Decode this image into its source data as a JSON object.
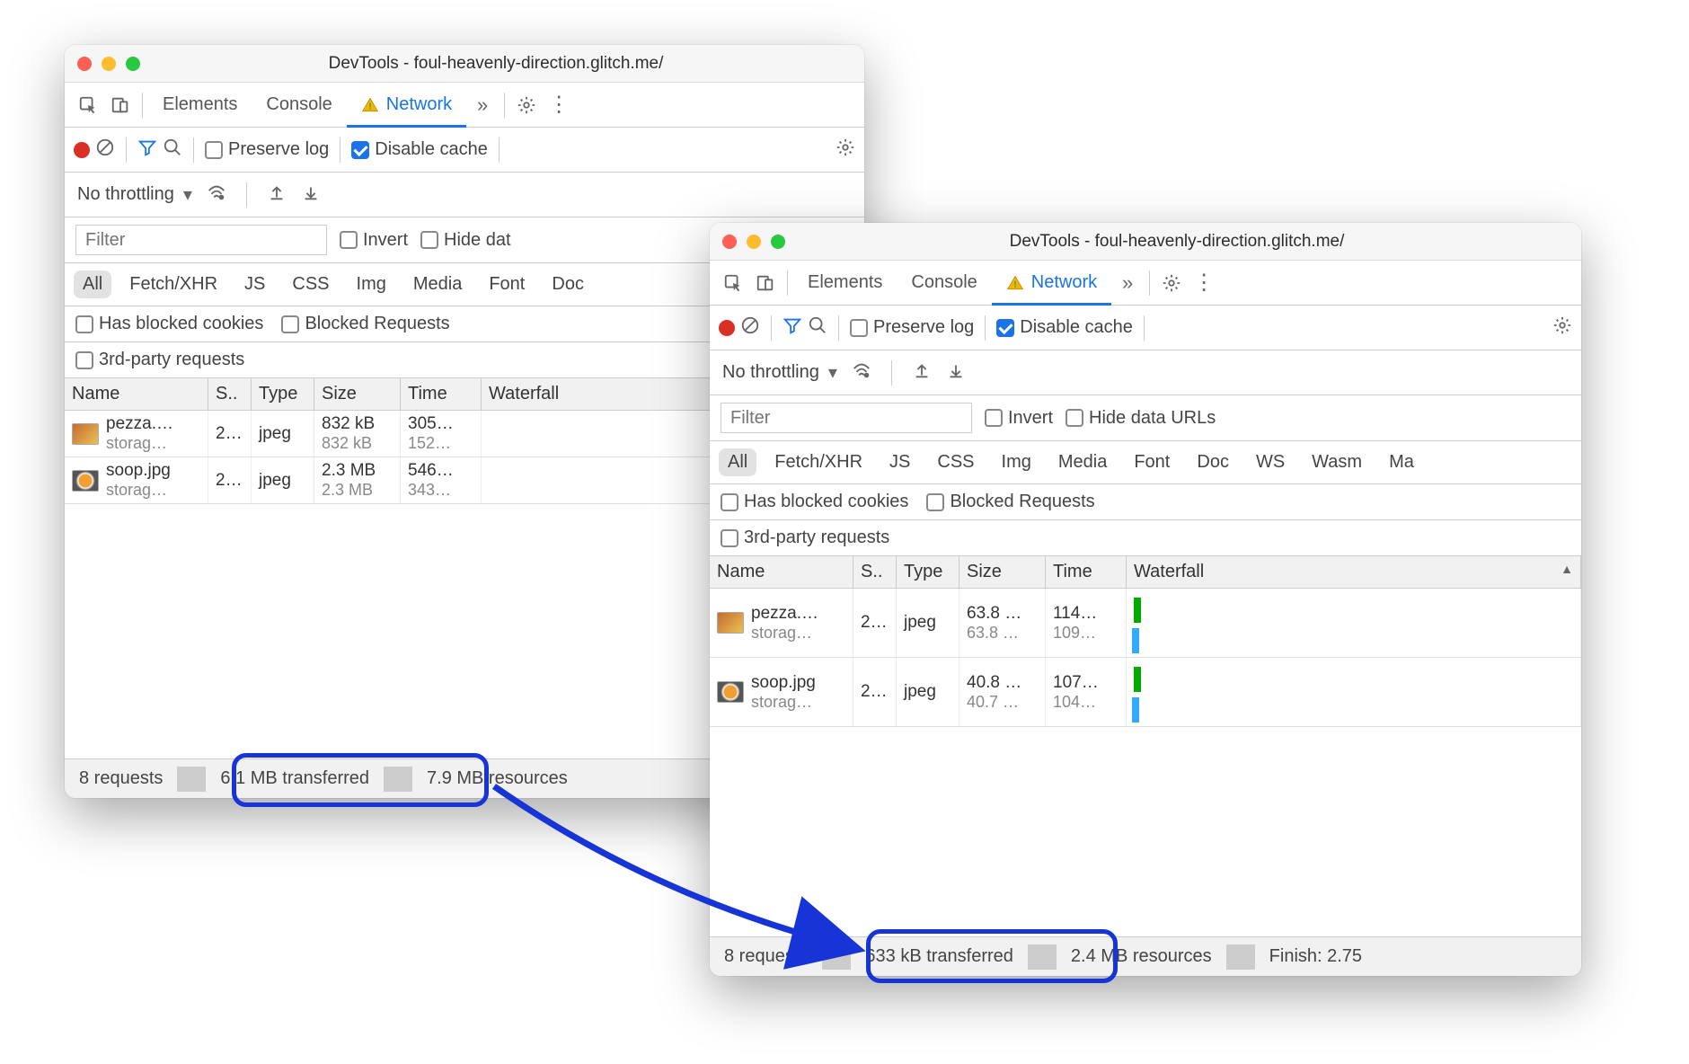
{
  "windows": [
    {
      "title": "DevTools - foul-heavenly-direction.glitch.me/",
      "tabs": {
        "elements": "Elements",
        "console": "Console",
        "network": "Network"
      },
      "toolbar": {
        "preserve_log": "Preserve log",
        "disable_cache": "Disable cache"
      },
      "throttling": "No throttling",
      "filter_placeholder": "Filter",
      "invert": "Invert",
      "hide_data": "Hide dat",
      "types": [
        "All",
        "Fetch/XHR",
        "JS",
        "CSS",
        "Img",
        "Media",
        "Font",
        "Doc"
      ],
      "checks": {
        "blocked_cookies": "Has blocked cookies",
        "blocked_requests": "Blocked Requests",
        "third_party": "3rd-party requests"
      },
      "columns": {
        "name": "Name",
        "status": "S..",
        "type": "Type",
        "size": "Size",
        "time": "Time",
        "waterfall": "Waterfall"
      },
      "rows": [
        {
          "name": "pezza.…",
          "domain": "storag…",
          "status": "2…",
          "type": "jpeg",
          "size": "832 kB",
          "size2": "832 kB",
          "time": "305…",
          "time2": "152…",
          "thumb": "pizza"
        },
        {
          "name": "soop.jpg",
          "domain": "storag…",
          "status": "2…",
          "type": "jpeg",
          "size": "2.3 MB",
          "size2": "2.3 MB",
          "time": "546…",
          "time2": "343…",
          "thumb": "soup"
        }
      ],
      "status": {
        "requests": "8 requests",
        "transferred": "6.1 MB transferred",
        "resources": "7.9 MB resources"
      }
    },
    {
      "title": "DevTools - foul-heavenly-direction.glitch.me/",
      "tabs": {
        "elements": "Elements",
        "console": "Console",
        "network": "Network"
      },
      "toolbar": {
        "preserve_log": "Preserve log",
        "disable_cache": "Disable cache"
      },
      "throttling": "No throttling",
      "filter_placeholder": "Filter",
      "invert": "Invert",
      "hide_data": "Hide data URLs",
      "types": [
        "All",
        "Fetch/XHR",
        "JS",
        "CSS",
        "Img",
        "Media",
        "Font",
        "Doc",
        "WS",
        "Wasm",
        "Ma"
      ],
      "checks": {
        "blocked_cookies": "Has blocked cookies",
        "blocked_requests": "Blocked Requests",
        "third_party": "3rd-party requests"
      },
      "columns": {
        "name": "Name",
        "status": "S..",
        "type": "Type",
        "size": "Size",
        "time": "Time",
        "waterfall": "Waterfall"
      },
      "rows": [
        {
          "name": "pezza.…",
          "domain": "storag…",
          "status": "2…",
          "type": "jpeg",
          "size": "63.8 …",
          "size2": "63.8 …",
          "time": "114…",
          "time2": "109…",
          "thumb": "pizza"
        },
        {
          "name": "soop.jpg",
          "domain": "storag…",
          "status": "2…",
          "type": "jpeg",
          "size": "40.8 …",
          "size2": "40.7 …",
          "time": "107…",
          "time2": "104…",
          "thumb": "soup"
        }
      ],
      "status": {
        "requests": "8 requests",
        "transferred": "633 kB transferred",
        "resources": "2.4 MB resources",
        "finish": "Finish: 2.75"
      }
    }
  ]
}
